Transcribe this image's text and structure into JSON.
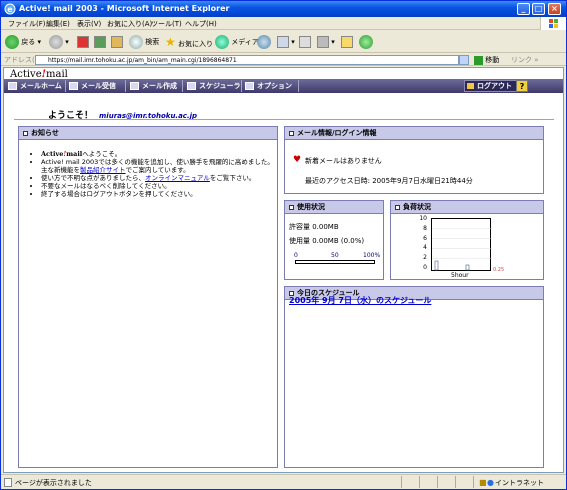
{
  "window": {
    "title": "Active! mail 2003 - Microsoft Internet Explorer"
  },
  "menu": [
    "ファイル(F)",
    "編集(E)",
    "表示(V)",
    "お気に入り(A)",
    "ツール(T)",
    "ヘルプ(H)"
  ],
  "toolbar": {
    "back": "戻る",
    "search": "検索",
    "favorites": "お気に入り",
    "media": "メディア"
  },
  "address": {
    "label": "アドレス(D)",
    "url": "https://mail.imr.tohoku.ac.jp/am_bin/am_main.cgi/1896864871",
    "go": "移動",
    "links": "リンク"
  },
  "app": {
    "logo_text": "Active",
    "logo_bang": "!",
    "logo_suffix": "mail",
    "nav": [
      "メールホーム",
      "メール受信",
      "メール作成",
      "スケジューラ",
      "オプション"
    ],
    "logout": "ログアウト",
    "help": "?"
  },
  "welcome": {
    "greeting": "ようこそ！",
    "user": "miuras@imr.tohoku.ac.jp"
  },
  "notice": {
    "header": "お知らせ",
    "item1_brand": "Active",
    "item1_bang": "!",
    "item1_brand2": "mail",
    "item1_rest": "へようこそ。",
    "item2_a": "Active! mail 2003では多くの機能を追加し、使い勝手を飛躍的に高めました。主な新機能を",
    "item2_link": "製品紹介サイト",
    "item2_b": "でご案内しています。",
    "item3_a": "使い方で不明な点がありましたら、",
    "item3_link": "オンラインマニュアル",
    "item3_b": "をご覧下さい。",
    "item4": "不要なメールはなるべく削除してください。",
    "item5": "終了する場合はログアウトボタンを押してください。"
  },
  "mailinfo": {
    "header": "メール情報/ログイン情報",
    "new_mail": "新着メールはありません",
    "last_access": "最近のアクセス日時:  2005年9月7日水曜日21時44分"
  },
  "usage": {
    "header": "使用状況",
    "quota": "許容量 0.00MB",
    "used": "使用量 0.00MB (0.0%)",
    "scale": [
      "0",
      "50",
      "100%"
    ],
    "percent": 0
  },
  "load": {
    "header": "負荷状況",
    "y_ticks": [
      "10",
      "8",
      "6",
      "4",
      "2",
      "0"
    ],
    "x_label": "5hour",
    "data_label": "0.25",
    "ylim": [
      0,
      10
    ]
  },
  "schedule": {
    "header": "今日のスケジュール",
    "link": "2005年 9月 7日（水）のスケジュール"
  },
  "status": {
    "message": "ページが表示されました",
    "zone": "イントラネット"
  }
}
